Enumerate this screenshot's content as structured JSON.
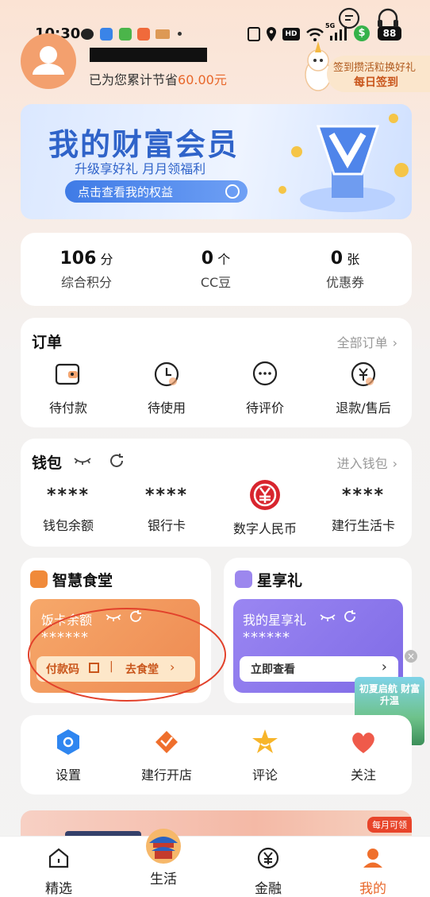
{
  "status_bar": {
    "time": "10:30",
    "battery": "88",
    "signal": "5G"
  },
  "profile": {
    "saved_prefix": "已为您累计节省",
    "saved_amount": "60.00元"
  },
  "checkin": {
    "line1": "签到攒活粒换好礼",
    "line2": "每日签到"
  },
  "banner": {
    "title": "我的财富会员",
    "subtitle": "升级享好礼 月月领福利",
    "button": "点击查看我的权益"
  },
  "stats": [
    {
      "value": "106",
      "unit": "分",
      "label": "综合积分"
    },
    {
      "value": "0",
      "unit": "个",
      "label": "CC豆"
    },
    {
      "value": "0",
      "unit": "张",
      "label": "优惠券"
    }
  ],
  "orders": {
    "title": "订单",
    "all": "全部订单",
    "items": [
      {
        "label": "待付款",
        "icon": "wallet-icon"
      },
      {
        "label": "待使用",
        "icon": "clock-icon"
      },
      {
        "label": "待评价",
        "icon": "chat-icon"
      },
      {
        "label": "退款/售后",
        "icon": "yuan-refund-icon"
      }
    ]
  },
  "wallet": {
    "title": "钱包",
    "enter": "进入钱包",
    "items": [
      {
        "value": "****",
        "label": "钱包余额"
      },
      {
        "value": "****",
        "label": "银行卡"
      },
      {
        "label": "数字人民币"
      },
      {
        "value": "****",
        "label": "建行生活卡"
      }
    ]
  },
  "canteen": {
    "title": "智慧食堂",
    "card_label": "饭卡余额",
    "masked": "******",
    "pay_code": "付款码",
    "separator": "|",
    "go": "去食堂"
  },
  "star": {
    "title": "星享礼",
    "card_label": "我的星享礼",
    "masked": "******",
    "view": "立即查看"
  },
  "promo_float": {
    "text": "初夏启航 财富升温"
  },
  "services": [
    {
      "label": "设置",
      "icon": "settings-icon"
    },
    {
      "label": "建行开店",
      "icon": "shop-icon"
    },
    {
      "label": "评论",
      "icon": "star-icon"
    },
    {
      "label": "关注",
      "icon": "heart-icon"
    }
  ],
  "bottom_promo": {
    "tag": "每月可领"
  },
  "tabs": [
    {
      "label": "精选",
      "icon": "home-icon"
    },
    {
      "label": "生活",
      "icon": "temple-icon"
    },
    {
      "label": "金融",
      "icon": "yuan-icon"
    },
    {
      "label": "我的",
      "icon": "user-icon",
      "active": true
    }
  ],
  "colors": {
    "accent": "#e8672a",
    "banner_blue": "#2f63c9",
    "star_purple": "#7f6be6"
  }
}
